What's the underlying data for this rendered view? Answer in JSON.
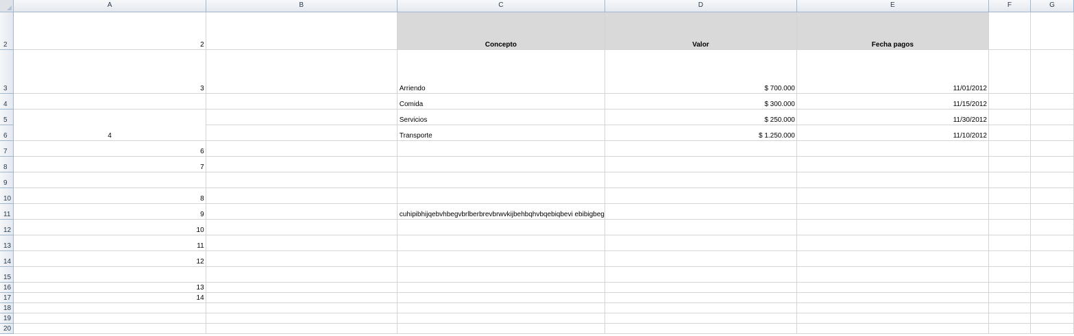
{
  "columns": [
    "A",
    "B",
    "C",
    "D",
    "E",
    "F",
    "G"
  ],
  "rows": [
    "2",
    "3",
    "4",
    "5",
    "6",
    "7",
    "8",
    "9",
    "10",
    "11",
    "12",
    "13",
    "14",
    "15",
    "16",
    "17",
    "18",
    "19",
    "20"
  ],
  "header": {
    "concepto": "Concepto",
    "valor": "Valor",
    "fecha": "Fecha pagos"
  },
  "colA": {
    "r2": "2",
    "r3": "3",
    "r6": "4",
    "r7": "6",
    "r8": "7",
    "r10": "8",
    "r11": "9",
    "r12": "10",
    "r13": "11",
    "r14": "12",
    "r16": "13",
    "r17": "14"
  },
  "items": [
    {
      "concepto": "Arriendo",
      "valor": "$ 700.000",
      "fecha": "11/01/2012"
    },
    {
      "concepto": "Comida",
      "valor": "$ 300.000",
      "fecha": "11/15/2012"
    },
    {
      "concepto": "Servicios",
      "valor": "$ 250.000",
      "fecha": "11/30/2012"
    },
    {
      "concepto": "Transporte",
      "valor": "$ 1.250.000",
      "fecha": "11/10/2012"
    }
  ],
  "c11_text": "cuhipibhijqebvhbegvbrlberbrevbrwvkijbehbqhvbqebiqbevi ebibigbeg",
  "colors": {
    "header_fill": "#d9d9d9",
    "header_text": "#c0282d",
    "gridline": "#d4d4d4",
    "header_border": "#9eb6ce"
  }
}
